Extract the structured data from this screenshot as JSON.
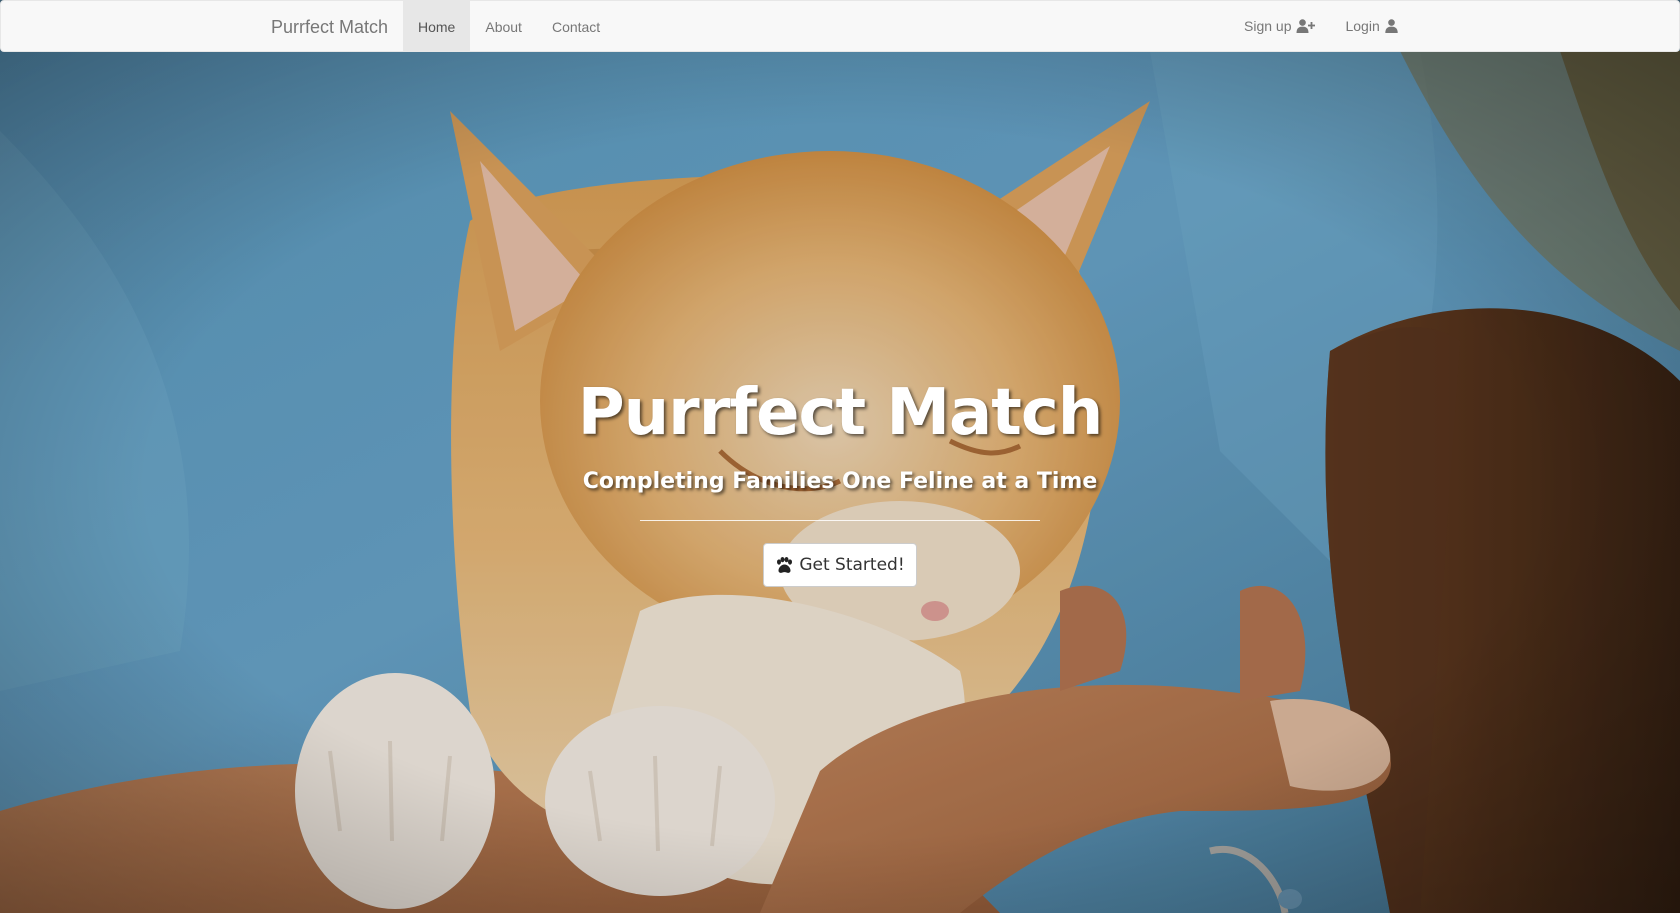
{
  "navbar": {
    "brand": "Purrfect Match",
    "links": [
      {
        "label": "Home",
        "active": true
      },
      {
        "label": "About",
        "active": false
      },
      {
        "label": "Contact",
        "active": false
      }
    ],
    "signup": {
      "label": "Sign up",
      "icon": "user-plus-icon"
    },
    "login": {
      "label": "Login",
      "icon": "user-icon"
    }
  },
  "hero": {
    "background_image": "orange kitten held in arms",
    "title": "Purrfect Match",
    "subtitle": "Completing Families One Feline at a Time",
    "cta": {
      "label": "Get Started!",
      "icon": "paw-icon"
    }
  },
  "colors": {
    "navbar_bg": "#f8f8f8",
    "navbar_text": "#777777",
    "active_tab_bg": "#e7e7e7",
    "hero_text": "#ffffff",
    "button_bg": "#ffffff"
  }
}
